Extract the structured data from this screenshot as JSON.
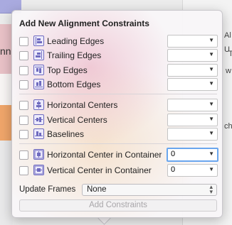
{
  "background": {
    "left_fragment_text": "nn",
    "right_fragments": [
      "Al",
      "U",
      "T",
      "w",
      "ch"
    ]
  },
  "popover": {
    "title": "Add New Alignment Constraints",
    "rows": [
      {
        "label": "Leading Edges",
        "icon": "leading-edges-icon",
        "value": ""
      },
      {
        "label": "Trailing Edges",
        "icon": "trailing-edges-icon",
        "value": ""
      },
      {
        "label": "Top Edges",
        "icon": "top-edges-icon",
        "value": ""
      },
      {
        "label": "Bottom Edges",
        "icon": "bottom-edges-icon",
        "value": ""
      },
      {
        "label": "Horizontal Centers",
        "icon": "horizontal-centers-icon",
        "value": ""
      },
      {
        "label": "Vertical Centers",
        "icon": "vertical-centers-icon",
        "value": ""
      },
      {
        "label": "Baselines",
        "icon": "baselines-icon",
        "value": ""
      },
      {
        "label": "Horizontal Center in Container",
        "icon": "horizontal-center-container-icon",
        "value": "0"
      },
      {
        "label": "Vertical Center in Container",
        "icon": "vertical-center-container-icon",
        "value": "0"
      }
    ],
    "update_frames": {
      "label": "Update Frames",
      "value": "None"
    },
    "add_button": "Add Constraints",
    "colors": {
      "accent_focus": "#6aa6ee",
      "icon_stroke": "#6f6bbf"
    }
  }
}
